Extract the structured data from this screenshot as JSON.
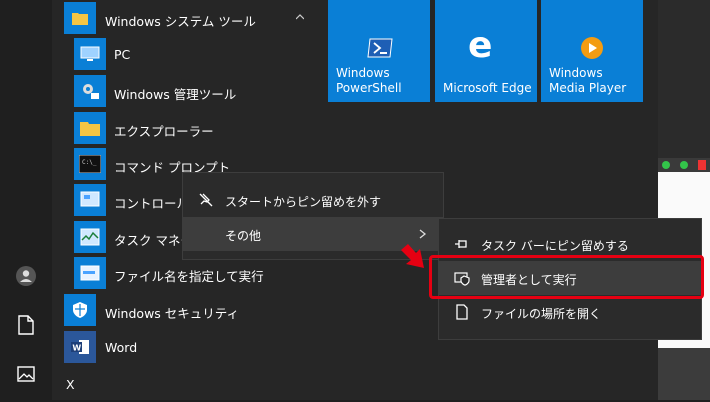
{
  "folder": {
    "label": "Windows システム ツール"
  },
  "apps": [
    {
      "label": "PC",
      "icon": "computer-icon"
    },
    {
      "label": "Windows 管理ツール",
      "icon": "admin-tools-icon"
    },
    {
      "label": "エクスプローラー",
      "icon": "folder-icon"
    },
    {
      "label": "コマンド プロンプト",
      "icon": "cmd-icon"
    },
    {
      "label": "コントロール パ",
      "icon": "control-panel-icon"
    },
    {
      "label": "タスク マネージ",
      "icon": "task-manager-icon"
    },
    {
      "label": "ファイル名を指定して実行",
      "icon": "run-icon"
    },
    {
      "label": "Windows セキュリティ",
      "icon": "shield-icon"
    },
    {
      "label": "Word",
      "icon": "word-icon"
    },
    {
      "label": "X"
    }
  ],
  "tiles": [
    {
      "label": "Windows\nPowerShell",
      "icon": "powershell-icon"
    },
    {
      "label": "Microsoft Edge",
      "icon": "edge-icon"
    },
    {
      "label": "Windows\nMedia Player",
      "icon": "media-player-icon"
    }
  ],
  "context_menu": {
    "items": [
      {
        "label": "スタートからピン留めを外す",
        "icon": "unpin-icon"
      },
      {
        "label": "その他"
      }
    ]
  },
  "submenu": {
    "items": [
      {
        "label": "タスク バーにピン留めする",
        "icon": "pin-icon"
      },
      {
        "label": "管理者として実行",
        "icon": "admin-shield-icon"
      },
      {
        "label": "ファイルの場所を開く",
        "icon": "file-icon"
      }
    ]
  },
  "colors": {
    "tile": "#0a7fd6",
    "highlight": "#e60012",
    "menu_bg": "#2b2b2b"
  }
}
